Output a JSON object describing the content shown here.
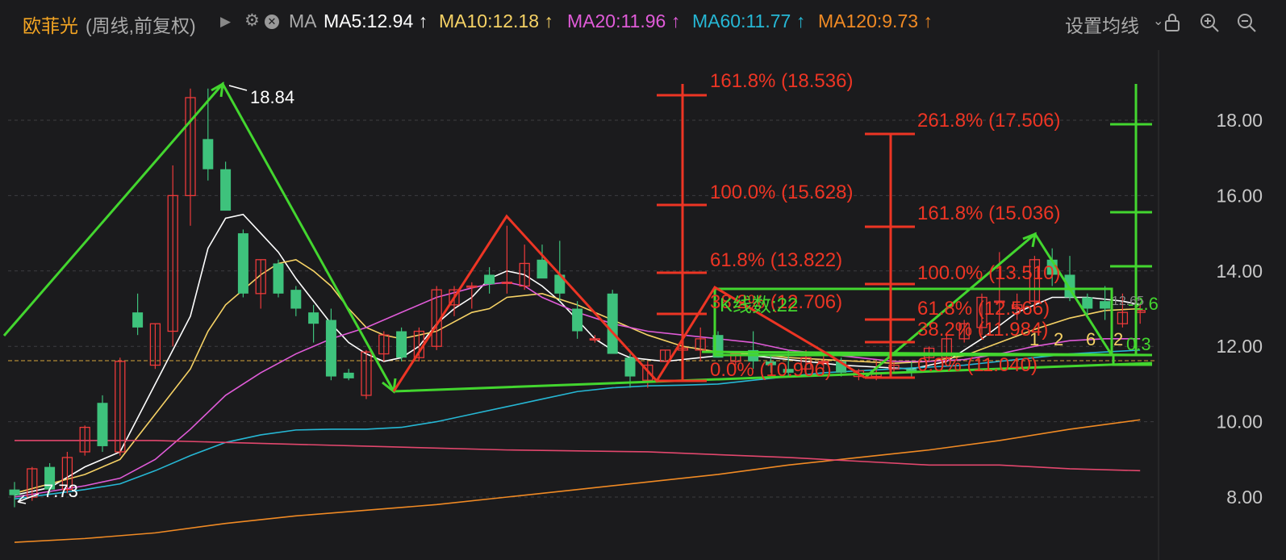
{
  "header": {
    "stock_name": "欧菲光",
    "mode": "(周线,前复权)",
    "indicator": "MA",
    "ma_settings": "设置均线",
    "ma_items": [
      {
        "label": "MA5:12.94 ↑",
        "color": "#ffffff"
      },
      {
        "label": "MA10:12.18 ↑",
        "color": "#f6d265"
      },
      {
        "label": "MA20:11.96 ↑",
        "color": "#e05bd8"
      },
      {
        "label": "MA60:11.77 ↑",
        "color": "#26b7d4"
      },
      {
        "label": "MA120:9.73 ↑",
        "color": "#f08a24"
      }
    ],
    "icons": [
      "expand-arrow-icon",
      "gear-icon",
      "close-circle-icon",
      "lock-icon",
      "zoom-in-icon",
      "zoom-out-icon"
    ]
  },
  "chart_data": {
    "type": "candlestick",
    "title": "",
    "ylim": [
      7.3,
      19.4
    ],
    "y_ticks": [
      "18.00",
      "16.00",
      "14.00",
      "12.00",
      "10.00",
      "8.00"
    ],
    "y_tick_values": [
      18,
      16,
      14,
      12,
      10,
      8
    ],
    "current_price_line": 11.62,
    "colors": {
      "up": "#ec3a3a",
      "down": "#3ec27c",
      "bg": "#1b1b1d",
      "grid": "#3d3d40",
      "trend": "#43d62f",
      "fib": "#ed3524"
    },
    "candles": [
      [
        8.2,
        8.4,
        7.73,
        8.05
      ],
      [
        8.0,
        8.8,
        7.9,
        8.75
      ],
      [
        8.8,
        8.9,
        8.1,
        8.2
      ],
      [
        8.2,
        9.2,
        8.1,
        9.05
      ],
      [
        9.2,
        9.9,
        9.1,
        9.85
      ],
      [
        10.5,
        10.7,
        9.2,
        9.35
      ],
      [
        9.2,
        11.7,
        9.1,
        11.6
      ],
      [
        12.9,
        13.4,
        12.3,
        12.5
      ],
      [
        11.5,
        12.6,
        11.4,
        12.6
      ],
      [
        12.4,
        16.8,
        12.0,
        16.0
      ],
      [
        16.0,
        18.84,
        15.2,
        18.6
      ],
      [
        17.5,
        18.84,
        16.4,
        16.7
      ],
      [
        16.7,
        16.9,
        15.8,
        15.6
      ],
      [
        15.0,
        15.1,
        13.3,
        13.4
      ],
      [
        13.4,
        14.3,
        13.0,
        14.3
      ],
      [
        14.2,
        14.3,
        13.3,
        13.4
      ],
      [
        13.5,
        13.6,
        12.8,
        13.0
      ],
      [
        12.9,
        13.1,
        12.1,
        12.6
      ],
      [
        12.7,
        13.0,
        11.1,
        11.2
      ],
      [
        11.3,
        11.4,
        11.1,
        11.15
      ],
      [
        10.7,
        11.9,
        10.6,
        11.85
      ],
      [
        11.8,
        12.4,
        11.6,
        12.3
      ],
      [
        12.4,
        12.5,
        11.6,
        11.7
      ],
      [
        11.7,
        12.5,
        11.6,
        12.4
      ],
      [
        12.0,
        13.6,
        11.9,
        13.5
      ],
      [
        13.1,
        13.6,
        12.8,
        13.5
      ],
      [
        13.6,
        13.7,
        13.0,
        13.6
      ],
      [
        13.9,
        14.1,
        13.4,
        13.65
      ],
      [
        13.7,
        15.2,
        13.4,
        13.7
      ],
      [
        13.6,
        14.7,
        13.5,
        14.2
      ],
      [
        14.3,
        14.7,
        13.9,
        13.8
      ],
      [
        13.9,
        14.8,
        13.2,
        13.4
      ],
      [
        13.0,
        13.2,
        12.2,
        12.4
      ],
      [
        12.2,
        12.3,
        12.1,
        12.2
      ],
      [
        13.4,
        13.5,
        12.0,
        11.8
      ],
      [
        11.7,
        11.8,
        10.9,
        11.2
      ],
      [
        11.1,
        11.6,
        10.9,
        11.5
      ],
      [
        11.6,
        11.9,
        11.6,
        11.9
      ],
      [
        11.9,
        12.3,
        11.7,
        11.95
      ],
      [
        11.9,
        12.5,
        11.6,
        12.2
      ],
      [
        12.3,
        12.4,
        11.7,
        11.7
      ],
      [
        11.6,
        11.8,
        11.5,
        11.8
      ],
      [
        11.9,
        12.4,
        11.4,
        11.6
      ],
      [
        11.6,
        11.8,
        11.3,
        11.5
      ],
      [
        11.4,
        11.9,
        11.2,
        11.3
      ],
      [
        11.4,
        11.9,
        11.2,
        11.7
      ],
      [
        11.6,
        11.8,
        11.4,
        11.6
      ],
      [
        11.6,
        11.7,
        11.2,
        11.3
      ],
      [
        11.2,
        11.4,
        11.1,
        11.35
      ],
      [
        11.2,
        11.6,
        11.1,
        11.3
      ],
      [
        11.4,
        11.6,
        11.3,
        11.5
      ],
      [
        11.4,
        11.6,
        11.2,
        11.3
      ],
      [
        11.7,
        12.0,
        11.6,
        11.95
      ],
      [
        11.7,
        12.3,
        11.6,
        12.2
      ],
      [
        12.2,
        12.7,
        12.1,
        12.6
      ],
      [
        12.5,
        13.4,
        12.3,
        13.3
      ],
      [
        13.2,
        14.5,
        12.6,
        13.2
      ],
      [
        13.0,
        13.4,
        12.7,
        13.1
      ],
      [
        13.2,
        14.4,
        13.0,
        14.3
      ],
      [
        14.3,
        14.6,
        13.6,
        13.9
      ],
      [
        13.9,
        14.4,
        13.2,
        13.3
      ],
      [
        13.3,
        13.4,
        12.8,
        13.0
      ],
      [
        13.2,
        13.6,
        12.7,
        13.0
      ],
      [
        12.6,
        13.4,
        12.5,
        12.9
      ],
      [
        12.9,
        13.1,
        12.6,
        12.95
      ]
    ],
    "series": [
      {
        "name": "MA5",
        "color": "#ffffff",
        "values": [
          [
            0,
            8.05
          ],
          [
            2,
            8.25
          ],
          [
            4,
            8.8
          ],
          [
            6,
            9.2
          ],
          [
            8,
            11.0
          ],
          [
            10,
            12.8
          ],
          [
            11,
            14.6
          ],
          [
            12,
            15.4
          ],
          [
            13,
            15.5
          ],
          [
            14,
            15.0
          ],
          [
            15,
            14.5
          ],
          [
            16,
            13.8
          ],
          [
            17,
            13.2
          ],
          [
            18,
            12.6
          ],
          [
            19,
            12.1
          ],
          [
            20,
            11.8
          ],
          [
            21,
            11.6
          ],
          [
            22,
            11.7
          ],
          [
            23,
            12.0
          ],
          [
            24,
            12.6
          ],
          [
            25,
            13.0
          ],
          [
            26,
            13.3
          ],
          [
            27,
            13.8
          ],
          [
            28,
            14.0
          ],
          [
            29,
            13.9
          ],
          [
            30,
            13.6
          ],
          [
            31,
            13.2
          ],
          [
            32,
            12.7
          ],
          [
            33,
            12.2
          ],
          [
            34,
            11.9
          ],
          [
            35,
            11.7
          ],
          [
            37,
            11.6
          ],
          [
            39,
            11.7
          ],
          [
            41,
            11.8
          ],
          [
            43,
            11.7
          ],
          [
            45,
            11.6
          ],
          [
            47,
            11.5
          ],
          [
            49,
            11.45
          ],
          [
            51,
            11.4
          ],
          [
            53,
            11.6
          ],
          [
            55,
            12.2
          ],
          [
            57,
            12.9
          ],
          [
            59,
            13.3
          ],
          [
            61,
            13.3
          ],
          [
            63,
            13.2
          ],
          [
            64,
            13.1
          ]
        ]
      },
      {
        "name": "MA10",
        "color": "#f6d265",
        "values": [
          [
            0,
            8.1
          ],
          [
            4,
            8.6
          ],
          [
            6,
            9.0
          ],
          [
            8,
            10.2
          ],
          [
            10,
            11.4
          ],
          [
            11,
            12.4
          ],
          [
            12,
            13.1
          ],
          [
            14,
            13.9
          ],
          [
            15,
            14.2
          ],
          [
            16,
            14.3
          ],
          [
            17,
            14.0
          ],
          [
            18,
            13.6
          ],
          [
            19,
            13.0
          ],
          [
            20,
            12.5
          ],
          [
            21,
            12.3
          ],
          [
            22,
            12.2
          ],
          [
            24,
            12.4
          ],
          [
            26,
            12.9
          ],
          [
            27,
            13.0
          ],
          [
            28,
            13.3
          ],
          [
            30,
            13.4
          ],
          [
            32,
            13.1
          ],
          [
            34,
            12.7
          ],
          [
            36,
            12.3
          ],
          [
            38,
            12.0
          ],
          [
            40,
            11.85
          ],
          [
            42,
            11.8
          ],
          [
            44,
            11.7
          ],
          [
            46,
            11.65
          ],
          [
            48,
            11.6
          ],
          [
            50,
            11.55
          ],
          [
            52,
            11.6
          ],
          [
            54,
            11.75
          ],
          [
            56,
            12.1
          ],
          [
            58,
            12.45
          ],
          [
            60,
            12.75
          ],
          [
            62,
            12.95
          ],
          [
            64,
            13.0
          ]
        ]
      },
      {
        "name": "MA20",
        "color": "#e05bd8",
        "values": [
          [
            0,
            8.0
          ],
          [
            4,
            8.3
          ],
          [
            6,
            8.5
          ],
          [
            8,
            9.0
          ],
          [
            10,
            9.8
          ],
          [
            12,
            10.7
          ],
          [
            14,
            11.3
          ],
          [
            16,
            11.8
          ],
          [
            18,
            12.2
          ],
          [
            20,
            12.5
          ],
          [
            22,
            12.9
          ],
          [
            24,
            13.3
          ],
          [
            26,
            13.55
          ],
          [
            27,
            13.65
          ],
          [
            28,
            13.7
          ],
          [
            29,
            13.6
          ],
          [
            30,
            13.3
          ],
          [
            32,
            12.9
          ],
          [
            34,
            12.6
          ],
          [
            36,
            12.4
          ],
          [
            38,
            12.3
          ],
          [
            40,
            12.2
          ],
          [
            42,
            12.1
          ],
          [
            44,
            11.9
          ],
          [
            46,
            11.8
          ],
          [
            48,
            11.7
          ],
          [
            50,
            11.6
          ],
          [
            52,
            11.6
          ],
          [
            54,
            11.65
          ],
          [
            56,
            11.8
          ],
          [
            58,
            12.0
          ],
          [
            60,
            12.15
          ],
          [
            62,
            12.2
          ],
          [
            64,
            12.2
          ]
        ]
      },
      {
        "name": "MA60",
        "color": "#26b7d4",
        "values": [
          [
            0,
            7.95
          ],
          [
            4,
            8.2
          ],
          [
            6,
            8.35
          ],
          [
            8,
            8.7
          ],
          [
            10,
            9.1
          ],
          [
            12,
            9.45
          ],
          [
            14,
            9.65
          ],
          [
            16,
            9.78
          ],
          [
            18,
            9.8
          ],
          [
            20,
            9.8
          ],
          [
            22,
            9.85
          ],
          [
            24,
            10.0
          ],
          [
            26,
            10.2
          ],
          [
            28,
            10.4
          ],
          [
            30,
            10.6
          ],
          [
            32,
            10.8
          ],
          [
            34,
            10.9
          ],
          [
            36,
            10.95
          ],
          [
            38,
            10.97
          ],
          [
            40,
            11.0
          ],
          [
            42,
            11.1
          ],
          [
            44,
            11.2
          ],
          [
            46,
            11.3
          ],
          [
            48,
            11.35
          ],
          [
            50,
            11.4
          ],
          [
            52,
            11.45
          ],
          [
            54,
            11.5
          ],
          [
            56,
            11.6
          ],
          [
            58,
            11.7
          ],
          [
            60,
            11.8
          ],
          [
            62,
            11.85
          ],
          [
            64,
            11.9
          ]
        ]
      },
      {
        "name": "MA120",
        "color": "#f08a24",
        "values": [
          [
            0,
            6.8
          ],
          [
            4,
            6.9
          ],
          [
            8,
            7.05
          ],
          [
            12,
            7.3
          ],
          [
            16,
            7.5
          ],
          [
            20,
            7.65
          ],
          [
            24,
            7.8
          ],
          [
            28,
            8.0
          ],
          [
            32,
            8.2
          ],
          [
            36,
            8.4
          ],
          [
            40,
            8.6
          ],
          [
            44,
            8.85
          ],
          [
            48,
            9.05
          ],
          [
            52,
            9.25
          ],
          [
            56,
            9.5
          ],
          [
            60,
            9.8
          ],
          [
            64,
            10.05
          ]
        ]
      },
      {
        "name": "MA250",
        "color": "#e2476d",
        "values": [
          [
            0,
            9.5
          ],
          [
            8,
            9.5
          ],
          [
            12,
            9.45
          ],
          [
            20,
            9.35
          ],
          [
            28,
            9.25
          ],
          [
            36,
            9.2
          ],
          [
            44,
            9.05
          ],
          [
            48,
            8.95
          ],
          [
            52,
            8.85
          ],
          [
            56,
            8.85
          ],
          [
            60,
            8.75
          ],
          [
            64,
            8.7
          ]
        ]
      }
    ],
    "annotations": {
      "high_label": "18.84",
      "low_label": "7.73",
      "k_count": "K线数:22",
      "partial_right": [
        "0.3",
        "-2.6",
        "12.65",
        "1",
        "2",
        "6",
        "2"
      ],
      "fib_1": {
        "labels": [
          "161.8% (18.536)",
          "100.0% (15.628)",
          "61.8%  (13.822)",
          "38.2%  (12.706)",
          "0.0%   (10.906)"
        ],
        "levels": [
          18.536,
          15.628,
          13.822,
          12.706,
          10.906
        ]
      },
      "fib_2": {
        "labels": [
          "261.8% (17.506)",
          "161.8% (15.036)",
          "100.0% (13.510)",
          "61.8%  (12.566)",
          "38.2%  (11.984)",
          "0.0%   (11.040)"
        ],
        "levels": [
          17.506,
          15.036,
          13.51,
          12.566,
          11.984,
          11.04
        ]
      }
    }
  }
}
